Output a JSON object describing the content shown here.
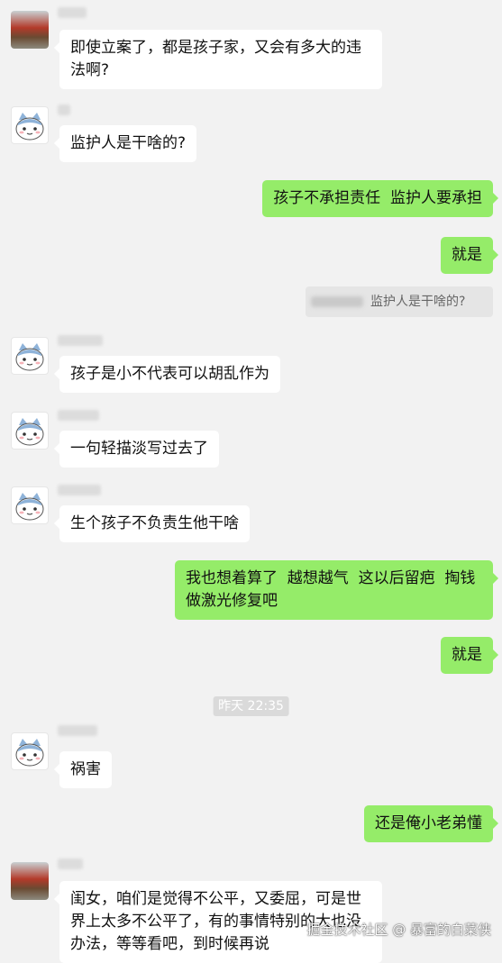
{
  "messages": [
    {
      "side": "in",
      "avatar": "photo",
      "text": "即使立案了，都是孩子家，又会有多大的违\n法啊?"
    },
    {
      "side": "in",
      "avatar": "cat",
      "text": "监护人是干啥的?"
    },
    {
      "side": "out",
      "text": "孩子不承担责任  监护人要承担"
    },
    {
      "side": "out",
      "text": "就是"
    },
    {
      "side": "quote",
      "text": "监护人是干啥的?"
    },
    {
      "side": "in",
      "avatar": "cat",
      "text": "孩子是小不代表可以胡乱作为"
    },
    {
      "side": "in",
      "avatar": "cat",
      "text": "一句轻描淡写过去了"
    },
    {
      "side": "in",
      "avatar": "cat",
      "text": "生个孩子不负责生他干啥"
    },
    {
      "side": "out",
      "text": "我也想着算了  越想越气  这以后留疤  掏钱\n做激光修复吧"
    },
    {
      "side": "out",
      "text": "就是"
    },
    {
      "side": "time",
      "text": "昨天 22:35"
    },
    {
      "side": "in",
      "avatar": "cat",
      "text": "祸害"
    },
    {
      "side": "out",
      "text": "还是俺小老弟懂"
    },
    {
      "side": "in",
      "avatar": "photo",
      "text": "闺女，咱们是觉得不公平，又委屈，可是世\n界上太多不公平了，有的事情特别的大也没\n办法，等等看吧，到时候再说"
    }
  ],
  "watermark": "掘金技术社区 @ 暴富的白菜侠"
}
